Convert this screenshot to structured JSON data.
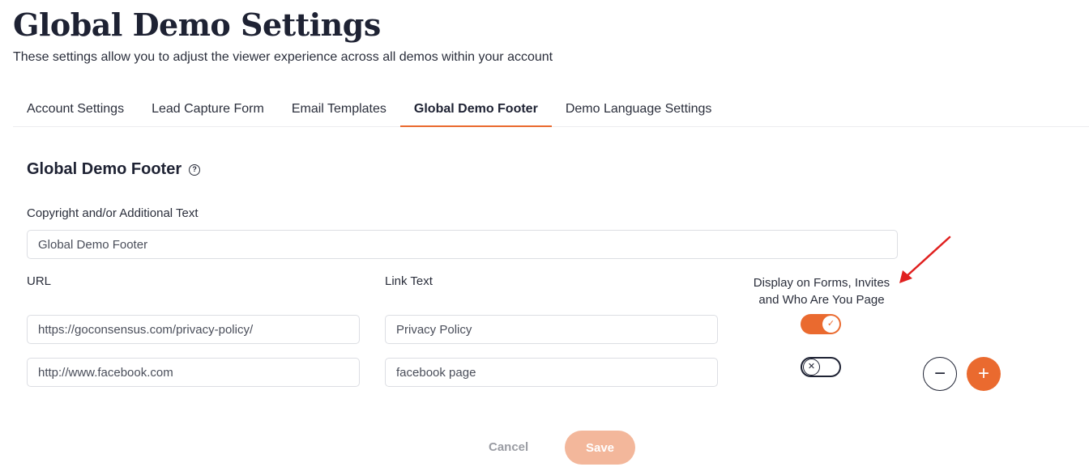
{
  "page": {
    "title": "Global Demo Settings",
    "subtitle": "These settings allow you to adjust the viewer experience across all demos within your account"
  },
  "tabs": [
    {
      "label": "Account Settings",
      "active": false
    },
    {
      "label": "Lead Capture Form",
      "active": false
    },
    {
      "label": "Email Templates",
      "active": false
    },
    {
      "label": "Global Demo Footer",
      "active": true
    },
    {
      "label": "Demo Language Settings",
      "active": false
    }
  ],
  "section": {
    "title": "Global Demo Footer",
    "help_icon": "question-circle-icon"
  },
  "copyright": {
    "label": "Copyright and/or Additional Text",
    "value": "Global Demo Footer"
  },
  "columns": {
    "url": "URL",
    "link_text": "Link Text",
    "display_line1": "Display on Forms, Invites",
    "display_line2": "and Who Are You Page"
  },
  "rows": [
    {
      "url": "https://goconsensus.com/privacy-policy/",
      "link_text": "Privacy Policy",
      "display": true
    },
    {
      "url": "http://www.facebook.com",
      "link_text": "facebook page",
      "display": false
    }
  ],
  "row_buttons": {
    "remove_icon": "−",
    "add_icon": "+"
  },
  "actions": {
    "cancel": "Cancel",
    "save": "Save"
  },
  "colors": {
    "accent": "#ea6a2f",
    "save_disabled": "#f3b79b",
    "annotation_arrow": "#e0201f"
  }
}
